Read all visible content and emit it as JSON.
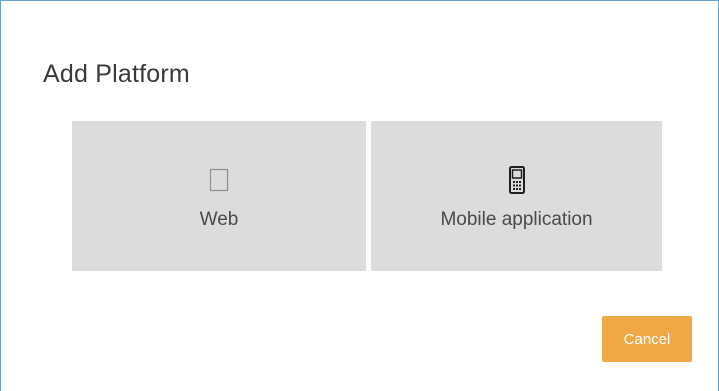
{
  "dialog": {
    "title": "Add Platform"
  },
  "platforms": [
    {
      "label": "Web",
      "icon": "web-page-icon"
    },
    {
      "label": "Mobile application",
      "icon": "mobile-phone-icon"
    }
  ],
  "actions": {
    "cancel_label": "Cancel"
  },
  "colors": {
    "tile_background": "#dcdcdc",
    "cancel_button": "#f0a847",
    "dialog_border": "#6aa0cf"
  }
}
